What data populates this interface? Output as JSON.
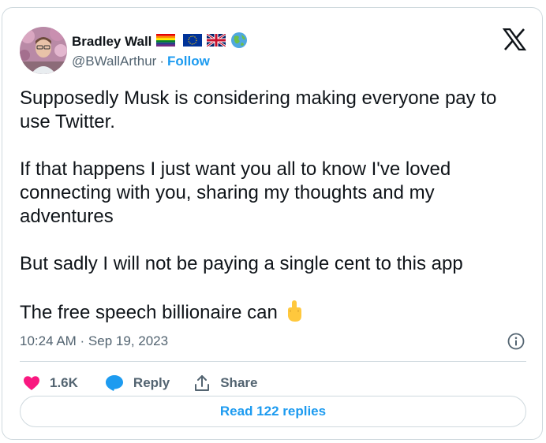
{
  "tweet": {
    "author": {
      "display_name": "Bradley Wall",
      "handle": "@BWallArthur",
      "separator": "·",
      "follow_label": "Follow",
      "flag_icons": [
        "rainbow-flag-icon",
        "eu-flag-icon",
        "uk-flag-icon",
        "globe-icon"
      ]
    },
    "paragraphs": [
      "Supposedly Musk is considering making everyone pay to use Twitter.",
      "If that happens I just want you all to know I've loved connecting with you, sharing my thoughts and my adventures",
      "But sadly I will not be paying a single cent to this app",
      "The free speech billionaire can"
    ],
    "timestamp": "10:24 AM · Sep 19, 2023",
    "actions": {
      "like_count": "1.6K",
      "reply_label": "Reply",
      "share_label": "Share"
    },
    "read_replies_label": "Read 122 replies"
  },
  "colors": {
    "accent": "#1d9bf0",
    "like": "#f91880",
    "secondary_text": "#536471",
    "border": "#cfd9de"
  }
}
